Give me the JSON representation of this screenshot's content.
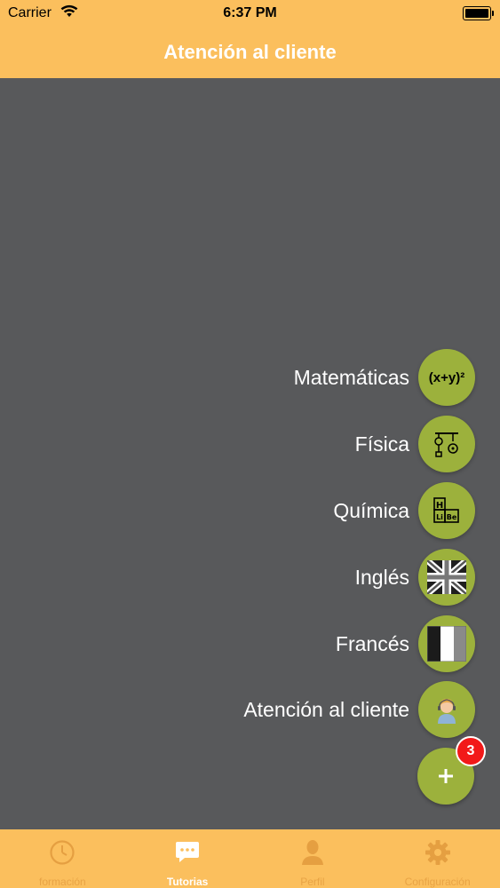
{
  "status_bar": {
    "carrier": "Carrier",
    "time": "6:37 PM"
  },
  "nav": {
    "title": "Atención al cliente"
  },
  "fab_menu": {
    "items": [
      {
        "label": "Matemáticas",
        "icon": "formula-icon"
      },
      {
        "label": "Física",
        "icon": "pulley-icon"
      },
      {
        "label": "Química",
        "icon": "periodic-table-icon"
      },
      {
        "label": "Inglés",
        "icon": "uk-flag-icon"
      },
      {
        "label": "Francés",
        "icon": "france-flag-icon"
      },
      {
        "label": "Atención al cliente",
        "icon": "support-agent-icon"
      }
    ],
    "main_button_icon": "plus-icon",
    "badge_count": "3",
    "math_text": "(x+y)²"
  },
  "tab_bar": {
    "tabs": [
      {
        "label": "formación",
        "icon": "clock-icon",
        "active": false
      },
      {
        "label": "Tutorias",
        "icon": "chat-bubble-icon",
        "active": true
      },
      {
        "label": "Perfil",
        "icon": "person-icon",
        "active": false
      },
      {
        "label": "Configuración",
        "icon": "gear-icon",
        "active": false
      }
    ]
  },
  "colors": {
    "primary": "#fbbf5d",
    "background": "#58595b",
    "fab": "#9cb13c",
    "badge": "#f21919",
    "inactive_tab": "#e59f41"
  }
}
